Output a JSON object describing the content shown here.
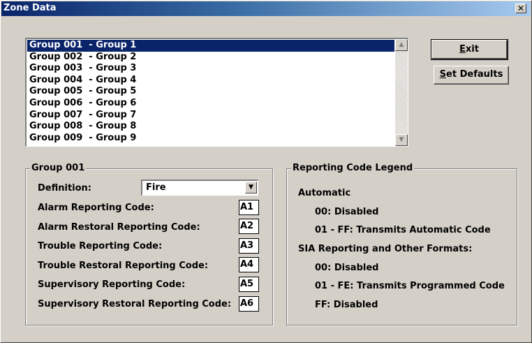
{
  "window": {
    "title": "Zone Data",
    "close_glyph": "✕"
  },
  "groups_list": {
    "items": [
      "Group 001  - Group 1",
      "Group 002  - Group 2",
      "Group 003  - Group 3",
      "Group 004  - Group 4",
      "Group 005  - Group 5",
      "Group 006  - Group 6",
      "Group 007  - Group 7",
      "Group 008  - Group 8",
      "Group 009  - Group 9"
    ],
    "selected_index": 0
  },
  "buttons": {
    "exit": "Exit",
    "set_defaults": "Set Defaults"
  },
  "group_panel": {
    "title": "Group 001",
    "definition_label": "Definition:",
    "definition_value": "Fire",
    "rows": [
      {
        "label": "Alarm Reporting Code:",
        "code": "A1"
      },
      {
        "label": "Alarm Restoral Reporting Code:",
        "code": "A2"
      },
      {
        "label": "Trouble Reporting Code:",
        "code": "A3"
      },
      {
        "label": "Trouble Restoral Reporting Code:",
        "code": "A4"
      },
      {
        "label": "Supervisory Reporting Code:",
        "code": "A5"
      },
      {
        "label": "Supervisory Restoral Reporting Code:",
        "code": "A6"
      }
    ]
  },
  "legend_panel": {
    "title": "Reporting Code Legend",
    "automatic_heading": "Automatic",
    "automatic_lines": [
      "00: Disabled",
      "01 - FF: Transmits Automatic Code"
    ],
    "sia_heading": "SIA Reporting and Other Formats:",
    "sia_lines": [
      "00: Disabled",
      "01 - FE: Transmits Programmed Code",
      "FF: Disabled"
    ]
  },
  "icons": {
    "scroll_up": "▲",
    "scroll_down": "▼",
    "combo_arrow": "▼"
  }
}
